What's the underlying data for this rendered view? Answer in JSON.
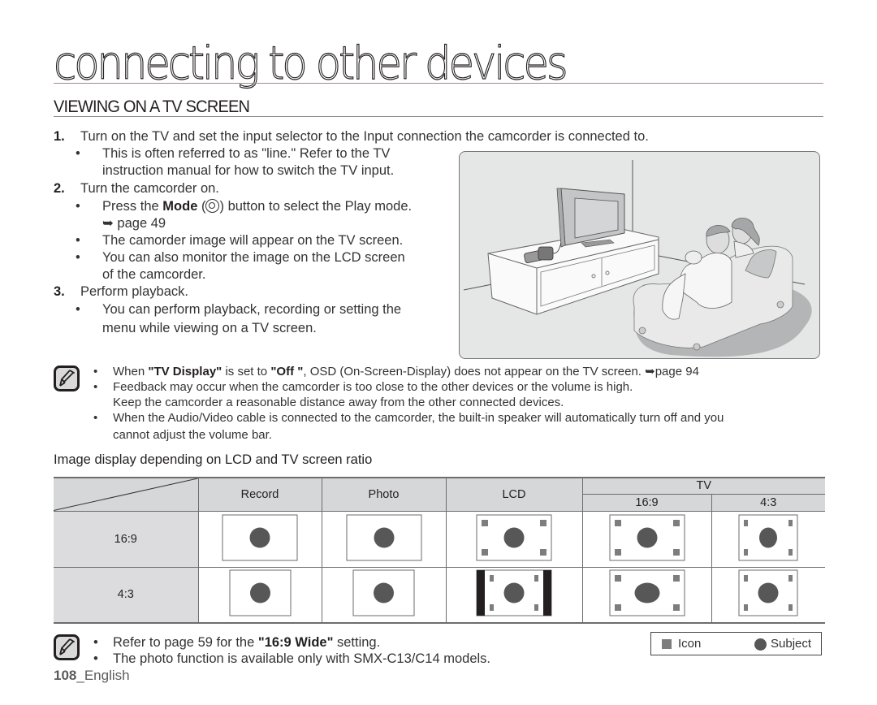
{
  "chapter": {
    "title": "connecting to other devices"
  },
  "section": {
    "title": "VIEWING ON A TV SCREEN"
  },
  "steps": [
    {
      "num": "1.",
      "text": "Turn on the TV and set the input selector to the Input connection the camcorder is connected to.",
      "bullets": [
        {
          "lines": [
            "This is often referred to as \"line.\" Refer to the TV",
            "instruction manual for how to switch the TV input."
          ]
        }
      ]
    },
    {
      "num": "2.",
      "text": "Turn the camcorder on.",
      "bullets": [
        {
          "pre": "Press the ",
          "bold": "Mode",
          "post": " button to select the Play mode.",
          "ref": "➥ page 49"
        },
        {
          "lines": [
            "The camorder image will appear on the TV screen."
          ]
        },
        {
          "lines": [
            "You can also monitor the image on the LCD screen",
            "of the camcorder."
          ]
        }
      ]
    },
    {
      "num": "3.",
      "text": "Perform playback.",
      "bullets": [
        {
          "lines": [
            "You can perform playback, recording or setting the",
            "menu while viewing on a TV screen."
          ]
        }
      ]
    }
  ],
  "bullet_char": "•",
  "illustration": {
    "description": "Couple on sofa watching TV connected to camcorder on TV stand"
  },
  "notes1": [
    {
      "pre": "When ",
      "b1": "\"TV Display\"",
      "mid": " is set to ",
      "b2": "\"Off \"",
      "post": ", OSD (On-Screen-Display) does not appear on the TV screen. ➥page 94"
    },
    {
      "lines": [
        "Feedback may occur when the camcorder is too close to the other devices or the volume is high.",
        "Keep the camcorder a reasonable distance away from the other connected devices."
      ]
    },
    {
      "lines": [
        "When the Audio/Video cable is connected to the camcorder, the built-in speaker will automatically turn off and you",
        "cannot adjust the volume bar."
      ]
    }
  ],
  "table": {
    "title": "Image display depending on LCD and TV screen ratio",
    "headers": {
      "record": "Record",
      "photo": "Photo",
      "lcd": "LCD",
      "tv": "TV",
      "tv_169": "16:9",
      "tv_43": "4:3"
    },
    "rows": [
      {
        "label": "16:9",
        "cells": [
          "wide-plain",
          "wide-plain",
          "wide-icons",
          "wide-icons",
          "narrow-squeezed"
        ]
      },
      {
        "label": "4:3",
        "cells": [
          "std-plain",
          "std-plain",
          "pillarbox",
          "wide-stretched",
          "std-icons"
        ]
      }
    ]
  },
  "notes2": [
    {
      "pre": "Refer to page 59 for the ",
      "bold": "\"16:9 Wide\"",
      "post": " setting."
    },
    {
      "text": "The photo function is available only with SMX-C13/C14 models."
    }
  ],
  "legend": {
    "icon_label": "Icon",
    "subject_label": "Subject"
  },
  "footer": {
    "page": "108",
    "lang": "_English"
  },
  "colors": {
    "icon_gray": "#7d7d7d",
    "subject_gray": "#575757",
    "header_bg": "#d6d7d9",
    "text": "#231f20"
  }
}
